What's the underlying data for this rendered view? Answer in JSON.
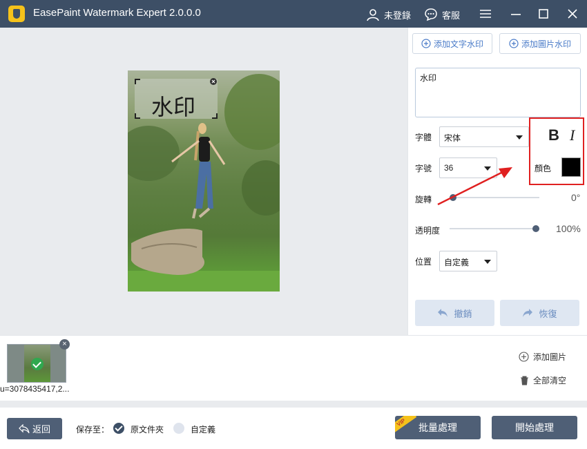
{
  "app": {
    "title": "EasePaint Watermark Expert  2.0.0.0",
    "user_label": "未登錄",
    "support_label": "客服"
  },
  "preview": {
    "watermark_text": "水印"
  },
  "panel": {
    "add_text_watermark": "添加文字水印",
    "add_image_watermark": "添加圖片水印",
    "text_value": "水印",
    "font_label": "字體",
    "font_value": "宋体",
    "bold_label": "B",
    "italic_label": "I",
    "size_label": "字號",
    "size_value": "36",
    "color_label": "顏色",
    "color_value": "#000000",
    "rotate_label": "旋轉",
    "rotate_value": "0°",
    "rotate_level": 0,
    "opacity_label": "透明度",
    "opacity_value": "100%",
    "opacity_level": 1,
    "position_label": "位置",
    "position_value": "自定義",
    "undo_label": "撤銷",
    "redo_label": "恢復"
  },
  "strip": {
    "thumbnail_name": "u=3078435417,2...",
    "add_image_label": "添加圖片",
    "clear_all_label": "全部清空"
  },
  "bottom": {
    "back_label": "返回",
    "save_to_label": "保存至：",
    "original_folder_label": "原文件夾",
    "custom_label": "自定義",
    "vip_badge": "VIP",
    "batch_label": "批量處理",
    "start_label": "開始處理"
  },
  "colors": {
    "titlebar": "#3d4f66",
    "accent": "#4a7bc8",
    "annotation_red": "#e02020"
  }
}
